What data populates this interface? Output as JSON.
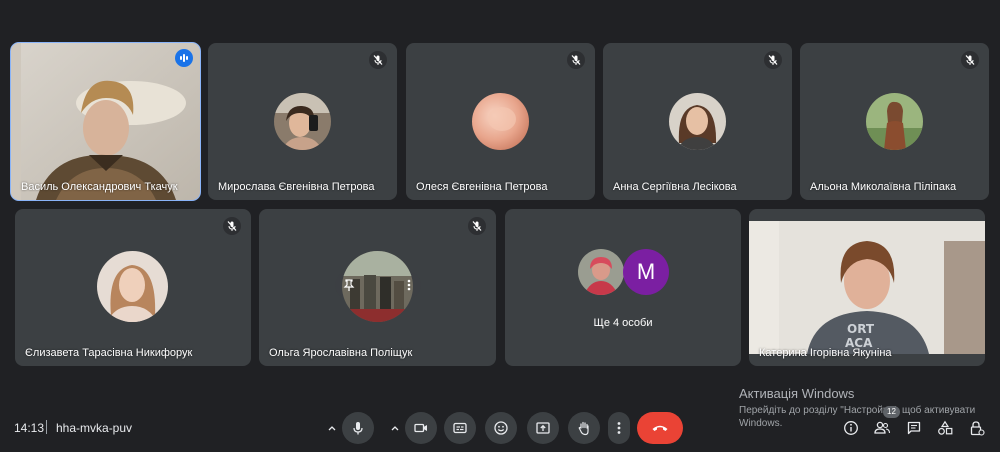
{
  "participants_row1": [
    {
      "name": "Василь Олександрович Ткачук",
      "speaking": true
    },
    {
      "name": "Мирослава Євгенівна Петрова",
      "speaking": false
    },
    {
      "name": "Олеся Євгенівна Петрова",
      "speaking": false
    },
    {
      "name": "Анна Сергіївна Лесікова",
      "speaking": false
    },
    {
      "name": "Альона Миколаївна Піліпака",
      "speaking": false
    }
  ],
  "participants_row2": [
    {
      "name": "Єлизавета Тарасівна Никифорук"
    },
    {
      "name": "Ольга Ярославівна Поліщук"
    },
    {
      "name": "Катерина Ігорівна Якуніна"
    }
  ],
  "more_tile": {
    "label": "Ще 4 особи",
    "letter": "M"
  },
  "bottom_bar": {
    "time": "14:13",
    "meeting_code": "hha-mvka-puv",
    "people_count": "12"
  },
  "windows_activation": {
    "title": "Активація Windows",
    "text": "Перейдіть до розділу \"Настройки\", щоб активувати Windows."
  },
  "colors": {
    "background": "#202124",
    "tile": "#3c4043",
    "accent": "#8ab4f8",
    "end_call": "#ea4335",
    "avatar_purple": "#7b1fa2"
  }
}
